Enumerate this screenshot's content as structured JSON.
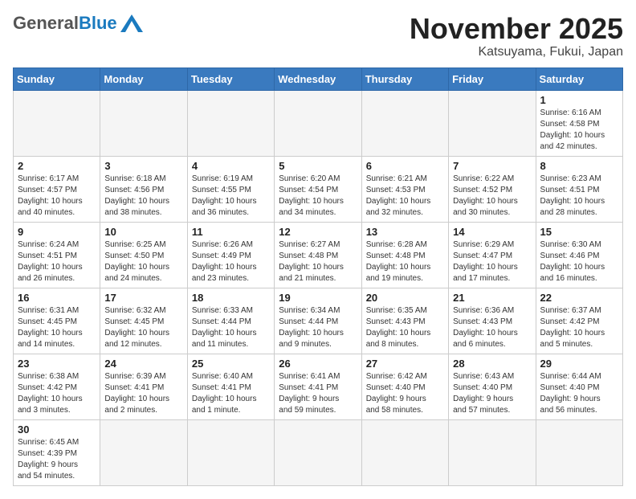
{
  "header": {
    "logo_general": "General",
    "logo_blue": "Blue",
    "month_title": "November 2025",
    "location": "Katsuyama, Fukui, Japan"
  },
  "weekdays": [
    "Sunday",
    "Monday",
    "Tuesday",
    "Wednesday",
    "Thursday",
    "Friday",
    "Saturday"
  ],
  "weeks": [
    [
      {
        "day": "",
        "info": ""
      },
      {
        "day": "",
        "info": ""
      },
      {
        "day": "",
        "info": ""
      },
      {
        "day": "",
        "info": ""
      },
      {
        "day": "",
        "info": ""
      },
      {
        "day": "",
        "info": ""
      },
      {
        "day": "1",
        "info": "Sunrise: 6:16 AM\nSunset: 4:58 PM\nDaylight: 10 hours\nand 42 minutes."
      }
    ],
    [
      {
        "day": "2",
        "info": "Sunrise: 6:17 AM\nSunset: 4:57 PM\nDaylight: 10 hours\nand 40 minutes."
      },
      {
        "day": "3",
        "info": "Sunrise: 6:18 AM\nSunset: 4:56 PM\nDaylight: 10 hours\nand 38 minutes."
      },
      {
        "day": "4",
        "info": "Sunrise: 6:19 AM\nSunset: 4:55 PM\nDaylight: 10 hours\nand 36 minutes."
      },
      {
        "day": "5",
        "info": "Sunrise: 6:20 AM\nSunset: 4:54 PM\nDaylight: 10 hours\nand 34 minutes."
      },
      {
        "day": "6",
        "info": "Sunrise: 6:21 AM\nSunset: 4:53 PM\nDaylight: 10 hours\nand 32 minutes."
      },
      {
        "day": "7",
        "info": "Sunrise: 6:22 AM\nSunset: 4:52 PM\nDaylight: 10 hours\nand 30 minutes."
      },
      {
        "day": "8",
        "info": "Sunrise: 6:23 AM\nSunset: 4:51 PM\nDaylight: 10 hours\nand 28 minutes."
      }
    ],
    [
      {
        "day": "9",
        "info": "Sunrise: 6:24 AM\nSunset: 4:51 PM\nDaylight: 10 hours\nand 26 minutes."
      },
      {
        "day": "10",
        "info": "Sunrise: 6:25 AM\nSunset: 4:50 PM\nDaylight: 10 hours\nand 24 minutes."
      },
      {
        "day": "11",
        "info": "Sunrise: 6:26 AM\nSunset: 4:49 PM\nDaylight: 10 hours\nand 23 minutes."
      },
      {
        "day": "12",
        "info": "Sunrise: 6:27 AM\nSunset: 4:48 PM\nDaylight: 10 hours\nand 21 minutes."
      },
      {
        "day": "13",
        "info": "Sunrise: 6:28 AM\nSunset: 4:48 PM\nDaylight: 10 hours\nand 19 minutes."
      },
      {
        "day": "14",
        "info": "Sunrise: 6:29 AM\nSunset: 4:47 PM\nDaylight: 10 hours\nand 17 minutes."
      },
      {
        "day": "15",
        "info": "Sunrise: 6:30 AM\nSunset: 4:46 PM\nDaylight: 10 hours\nand 16 minutes."
      }
    ],
    [
      {
        "day": "16",
        "info": "Sunrise: 6:31 AM\nSunset: 4:45 PM\nDaylight: 10 hours\nand 14 minutes."
      },
      {
        "day": "17",
        "info": "Sunrise: 6:32 AM\nSunset: 4:45 PM\nDaylight: 10 hours\nand 12 minutes."
      },
      {
        "day": "18",
        "info": "Sunrise: 6:33 AM\nSunset: 4:44 PM\nDaylight: 10 hours\nand 11 minutes."
      },
      {
        "day": "19",
        "info": "Sunrise: 6:34 AM\nSunset: 4:44 PM\nDaylight: 10 hours\nand 9 minutes."
      },
      {
        "day": "20",
        "info": "Sunrise: 6:35 AM\nSunset: 4:43 PM\nDaylight: 10 hours\nand 8 minutes."
      },
      {
        "day": "21",
        "info": "Sunrise: 6:36 AM\nSunset: 4:43 PM\nDaylight: 10 hours\nand 6 minutes."
      },
      {
        "day": "22",
        "info": "Sunrise: 6:37 AM\nSunset: 4:42 PM\nDaylight: 10 hours\nand 5 minutes."
      }
    ],
    [
      {
        "day": "23",
        "info": "Sunrise: 6:38 AM\nSunset: 4:42 PM\nDaylight: 10 hours\nand 3 minutes."
      },
      {
        "day": "24",
        "info": "Sunrise: 6:39 AM\nSunset: 4:41 PM\nDaylight: 10 hours\nand 2 minutes."
      },
      {
        "day": "25",
        "info": "Sunrise: 6:40 AM\nSunset: 4:41 PM\nDaylight: 10 hours\nand 1 minute."
      },
      {
        "day": "26",
        "info": "Sunrise: 6:41 AM\nSunset: 4:41 PM\nDaylight: 9 hours\nand 59 minutes."
      },
      {
        "day": "27",
        "info": "Sunrise: 6:42 AM\nSunset: 4:40 PM\nDaylight: 9 hours\nand 58 minutes."
      },
      {
        "day": "28",
        "info": "Sunrise: 6:43 AM\nSunset: 4:40 PM\nDaylight: 9 hours\nand 57 minutes."
      },
      {
        "day": "29",
        "info": "Sunrise: 6:44 AM\nSunset: 4:40 PM\nDaylight: 9 hours\nand 56 minutes."
      }
    ],
    [
      {
        "day": "30",
        "info": "Sunrise: 6:45 AM\nSunset: 4:39 PM\nDaylight: 9 hours\nand 54 minutes."
      },
      {
        "day": "",
        "info": ""
      },
      {
        "day": "",
        "info": ""
      },
      {
        "day": "",
        "info": ""
      },
      {
        "day": "",
        "info": ""
      },
      {
        "day": "",
        "info": ""
      },
      {
        "day": "",
        "info": ""
      }
    ]
  ]
}
